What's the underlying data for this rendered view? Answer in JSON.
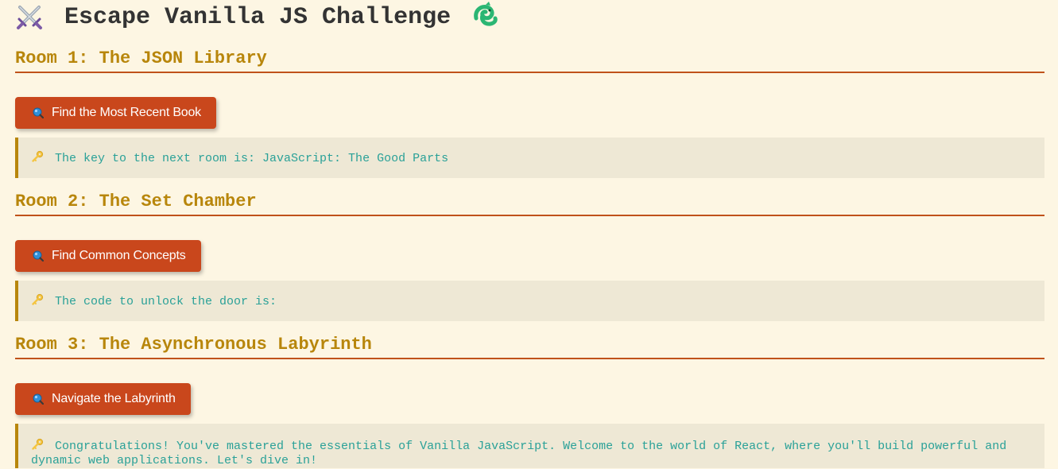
{
  "header": {
    "title": "Escape Vanilla JS Challenge",
    "left_icon": "crossed-swords-icon",
    "right_icon": "dragon-icon"
  },
  "rooms": [
    {
      "heading": "Room 1: The JSON Library",
      "button_label": "Find the Most Recent Book",
      "button_icon": "magnifying-glass-icon",
      "result_icon": "key-icon",
      "result_text": "The key to the next room is: JavaScript: The Good Parts"
    },
    {
      "heading": "Room 2: The Set Chamber",
      "button_label": "Find Common Concepts",
      "button_icon": "magnifying-glass-icon",
      "result_icon": "key-icon",
      "result_text": "The code to unlock the door is:"
    },
    {
      "heading": "Room 3: The Asynchronous Labyrinth",
      "button_label": "Navigate the Labyrinth",
      "button_icon": "magnifying-glass-icon",
      "result_icon": "key-icon",
      "result_text": "Congratulations! You've mastered the essentials of Vanilla JavaScript. Welcome to the world of React, where you'll build powerful and dynamic web applications. Let's dive in!"
    }
  ],
  "colors": {
    "background": "#fdf6e3",
    "heading": "#b8860b",
    "divider": "#c0521a",
    "button": "#c9471c",
    "result_bg": "#eee8d5",
    "result_text": "#2aa198"
  }
}
